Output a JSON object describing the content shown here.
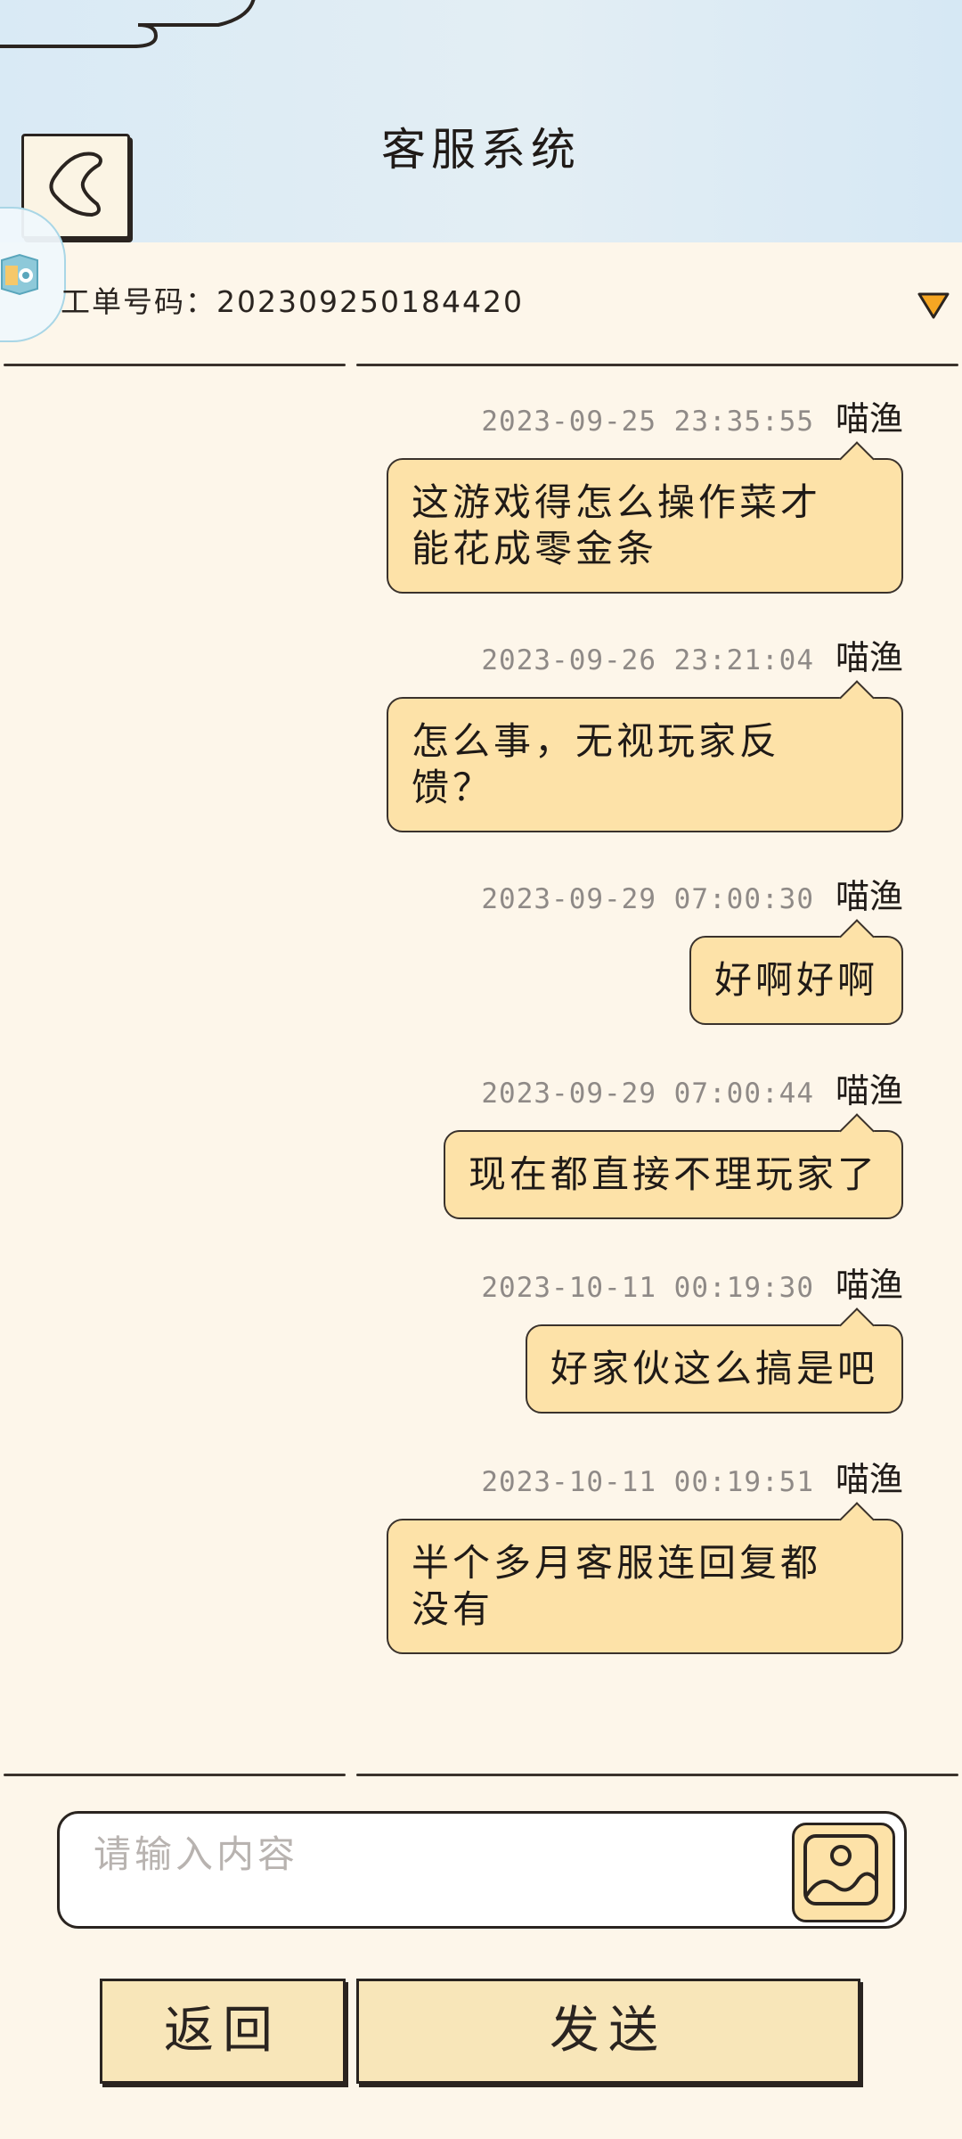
{
  "header": {
    "title": "客服系统"
  },
  "ticket": {
    "label": "工单号码：",
    "number": "202309250184420"
  },
  "messages": [
    {
      "timestamp": "2023-09-25 23:35:55",
      "sender": "喵渔",
      "lines": [
        "这游戏得怎么操作菜才",
        "能花成零金条"
      ]
    },
    {
      "timestamp": "2023-09-26 23:21:04",
      "sender": "喵渔",
      "lines": [
        "怎么事，无视玩家反",
        "馈？"
      ]
    },
    {
      "timestamp": "2023-09-29 07:00:30",
      "sender": "喵渔",
      "lines": [
        "好啊好啊"
      ]
    },
    {
      "timestamp": "2023-09-29 07:00:44",
      "sender": "喵渔",
      "lines": [
        "现在都直接不理玩家了"
      ]
    },
    {
      "timestamp": "2023-10-11 00:19:30",
      "sender": "喵渔",
      "lines": [
        "好家伙这么搞是吧"
      ]
    },
    {
      "timestamp": "2023-10-11 00:19:51",
      "sender": "喵渔",
      "lines": [
        "半个多月客服连回复都",
        "没有"
      ]
    }
  ],
  "input": {
    "placeholder": "请输入内容",
    "value": ""
  },
  "buttons": {
    "back": "返回",
    "send": "发送"
  },
  "colors": {
    "header_bg": "#d9eaf5",
    "page_bg": "#fdf6ea",
    "bubble_bg": "#fde2a8",
    "button_bg": "#f8e6b9",
    "dropdown_arrow": "#f5a623",
    "timestamp_text": "#8f8a87"
  },
  "icons": {
    "back": "chevron-left-icon",
    "dropdown": "triangle-down-icon",
    "image": "image-icon",
    "floating": "app-logo-icon"
  }
}
